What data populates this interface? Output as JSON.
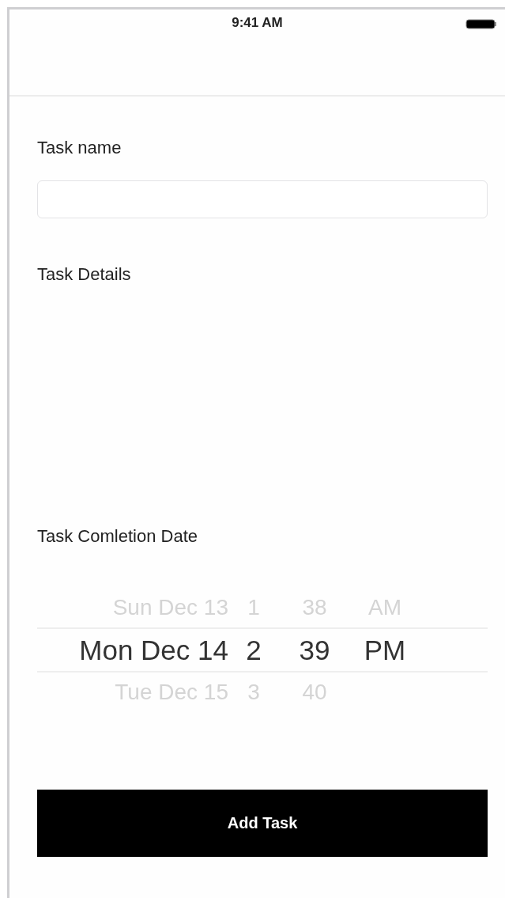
{
  "status_bar": {
    "time": "9:41 AM"
  },
  "form": {
    "name_label": "Task name",
    "details_label": "Task Details",
    "date_label": "Task Comletion Date"
  },
  "picker": {
    "rows": [
      {
        "selected": false,
        "cells": [
          "Sun Dec 13",
          "1",
          "38",
          "AM"
        ]
      },
      {
        "selected": true,
        "cells": [
          "Mon Dec 14",
          "2",
          "39",
          "PM"
        ]
      },
      {
        "selected": false,
        "cells": [
          "Tue Dec 15",
          "3",
          "40"
        ]
      }
    ]
  },
  "button": {
    "label": "Add Task"
  }
}
